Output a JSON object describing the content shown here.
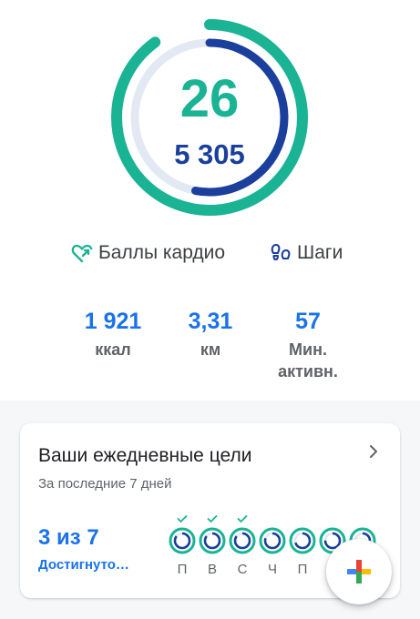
{
  "summary": {
    "cardio_points": "26",
    "steps": "5 305",
    "cardio_progress": 0.9,
    "steps_progress": 0.53,
    "colors": {
      "cardio": "#1ab394",
      "steps": "#1a3f9c",
      "track": "#e3e9f3"
    }
  },
  "legend": {
    "cardio_label": "Баллы кардио",
    "steps_label": "Шаги",
    "cardio_icon": "heart-arrow-icon",
    "steps_icon": "footsteps-icon"
  },
  "stats": {
    "kcal": {
      "value": "1 921",
      "label": "ккал"
    },
    "km": {
      "value": "3,31",
      "label": "км"
    },
    "min": {
      "value": "57",
      "label_line1": "Мин.",
      "label_line2": "активн."
    }
  },
  "goals_card": {
    "title": "Ваши ежедневные цели",
    "subtitle": "За последние 7 дней",
    "achieved": "3 из 7",
    "achieved_label": "Достигнуто…",
    "days": [
      {
        "label": "П",
        "met": true,
        "progress": 0.85
      },
      {
        "label": "В",
        "met": true,
        "progress": 0.85
      },
      {
        "label": "С",
        "met": true,
        "progress": 0.85
      },
      {
        "label": "Ч",
        "met": false,
        "progress": 0.8
      },
      {
        "label": "П",
        "met": false,
        "progress": 0.7
      },
      {
        "label": "",
        "met": false,
        "progress": 0.75
      },
      {
        "label": "",
        "met": false,
        "progress": 0.6
      }
    ]
  },
  "fab": {
    "icon": "plus-icon",
    "colors": [
      "#4285f4",
      "#ea4335",
      "#fbbc04",
      "#34a853"
    ]
  }
}
